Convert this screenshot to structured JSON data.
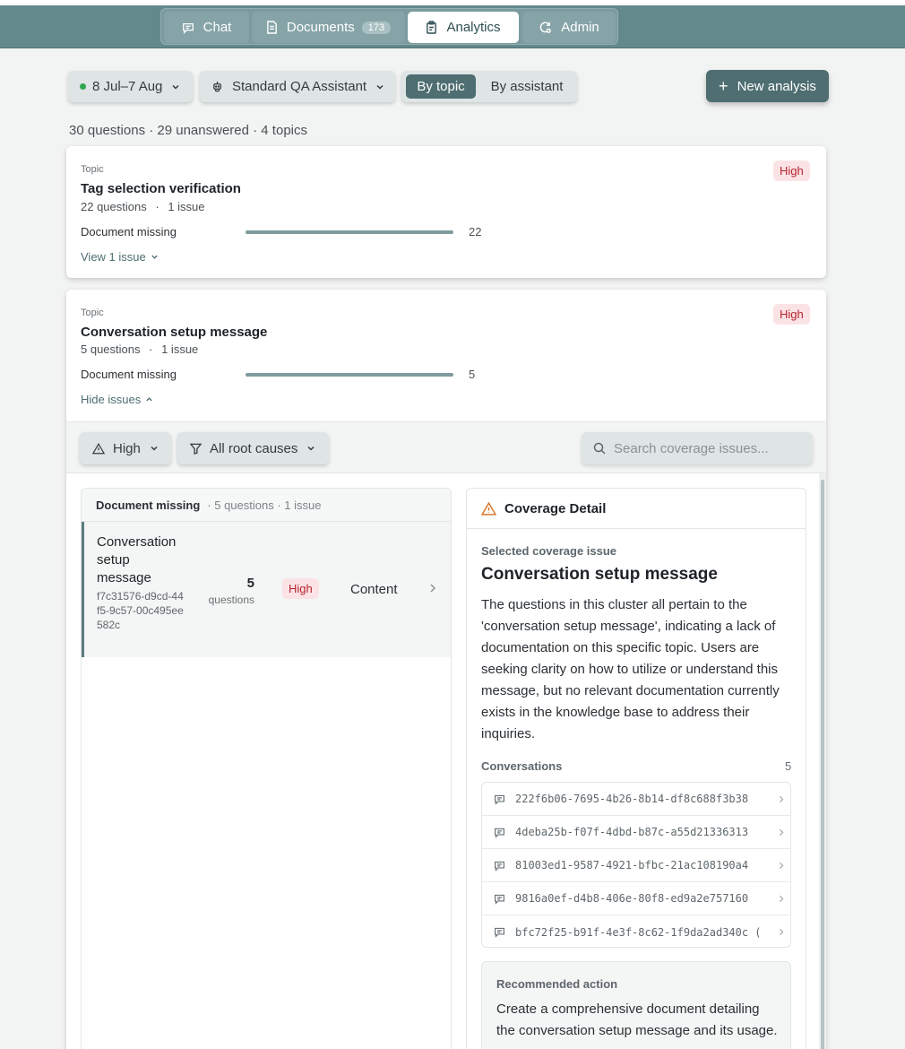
{
  "nav": {
    "tabs": [
      {
        "label": "Chat",
        "icon": "chat-icon"
      },
      {
        "label": "Documents",
        "icon": "document-icon",
        "badge": "173"
      },
      {
        "label": "Analytics",
        "icon": "clipboard-icon",
        "active": true
      },
      {
        "label": "Admin",
        "icon": "admin-icon"
      }
    ]
  },
  "toolbar": {
    "date_range": "8 Jul–7 Aug",
    "assistant": "Standard QA Assistant",
    "view_by_topic": "By topic",
    "view_by_assistant": "By assistant",
    "new_analysis": "New analysis"
  },
  "summary": "30 questions · 29 unanswered · 4 topics",
  "topics": [
    {
      "tag": "Topic",
      "title": "Tag selection verification",
      "questions": "22 questions",
      "issues": "1 issue",
      "severity": "High",
      "cause_label": "Document missing",
      "cause_count": "22",
      "toggle": "View 1 issue"
    },
    {
      "tag": "Topic",
      "title": "Conversation setup message",
      "questions": "5 questions",
      "issues": "1 issue",
      "severity": "High",
      "cause_label": "Document missing",
      "cause_count": "5",
      "toggle": "Hide issues"
    }
  ],
  "filters": {
    "severity": "High",
    "root_cause": "All root causes",
    "search_placeholder": "Search coverage issues..."
  },
  "issue_group": {
    "title": "Document missing",
    "meta": "· 5 questions · 1 issue",
    "row": {
      "title": "Conversation setup message",
      "id": "f7c31576-d9cd-44f5-9c57-00c495ee582c",
      "count": "5",
      "count_label": "questions",
      "severity": "High",
      "category": "Content"
    }
  },
  "detail": {
    "header": "Coverage Detail",
    "subtitle": "Selected coverage issue",
    "title": "Conversation setup message",
    "description": "The questions in this cluster all pertain to the 'conversation setup message', indicating a lack of documentation on this specific topic. Users are seeking clarity on how to utilize or understand this message, but no relevant documentation currently exists in the knowledge base to address their inquiries.",
    "conversations_label": "Conversations",
    "conversations_count": "5",
    "conversations": [
      "222f6b06-7695-4b26-8b14-df8c688f3b38",
      "4deba25b-f07f-4dbd-b87c-a55d21336313",
      "81003ed1-9587-4921-bfbc-21ac108190a4",
      "9816a0ef-d4b8-406e-80f8-ed9a2e757160",
      "bfc72f25-b91f-4e3f-8c62-1f9da2ad340c ("
    ],
    "recommended_label": "Recommended action",
    "recommended_text": "Create a comprehensive document detailing the conversation setup message and its usage."
  },
  "colors": {
    "accent": "#4e6e71",
    "topbar": "#63898c",
    "high_bg": "#fbe3e5",
    "high_text": "#b4232f"
  }
}
